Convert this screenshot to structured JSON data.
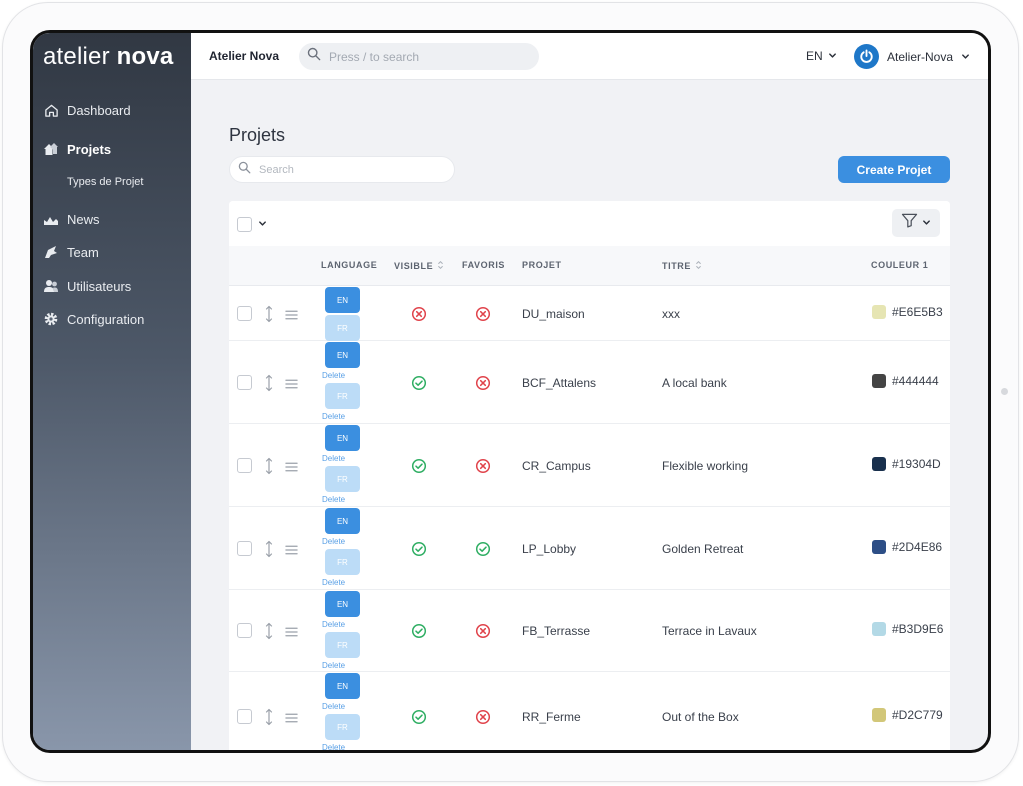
{
  "sidebar": {
    "logo_light": "atelier",
    "logo_bold": "nova",
    "items": [
      {
        "label": "Dashboard",
        "icon": "home-icon"
      },
      {
        "label": "Projets",
        "icon": "projects-icon"
      },
      {
        "label": "Types de Projet",
        "icon": ""
      },
      {
        "label": "News",
        "icon": "news-icon"
      },
      {
        "label": "Team",
        "icon": "team-icon"
      },
      {
        "label": "Utilisateurs",
        "icon": "users-icon"
      },
      {
        "label": "Configuration",
        "icon": "gear-icon"
      }
    ]
  },
  "header": {
    "brand": "Atelier Nova",
    "search_placeholder": "Press / to search",
    "language": "EN",
    "user": "Atelier-Nova"
  },
  "main": {
    "title": "Projets",
    "search_placeholder": "Search",
    "create_label": "Create Projet",
    "columns": {
      "language": "LANGUAGE",
      "visible": "VISIBLE",
      "favoris": "FAVORIS",
      "projet": "PROJET",
      "titre": "TITRE",
      "couleur": "COULEUR 1"
    },
    "lang_en": "EN",
    "lang_fr": "FR",
    "delete_label": "Delete",
    "rows": [
      {
        "projet": "DU_maison",
        "titre": "xxx",
        "visible": false,
        "favoris": false,
        "color": "#E6E5B3",
        "hex": "#E6E5B3"
      },
      {
        "projet": "BCF_Attalens",
        "titre": "A local bank",
        "visible": true,
        "favoris": false,
        "color": "#444444",
        "hex": "#444444"
      },
      {
        "projet": "CR_Campus",
        "titre": "Flexible working",
        "visible": true,
        "favoris": false,
        "color": "#19304D",
        "hex": "#19304D"
      },
      {
        "projet": "LP_Lobby",
        "titre": "Golden Retreat",
        "visible": true,
        "favoris": true,
        "color": "#2D4E86",
        "hex": "#2D4E86"
      },
      {
        "projet": "FB_Terrasse",
        "titre": "Terrace in Lavaux",
        "visible": true,
        "favoris": false,
        "color": "#B3D9E6",
        "hex": "#B3D9E6"
      },
      {
        "projet": "RR_Ferme",
        "titre": "Out of the Box",
        "visible": true,
        "favoris": false,
        "color": "#D2C779",
        "hex": "#D2C779"
      }
    ]
  },
  "colors": {
    "accent": "#3b8fe0",
    "ok": "#2fae63",
    "error": "#e0434b"
  }
}
